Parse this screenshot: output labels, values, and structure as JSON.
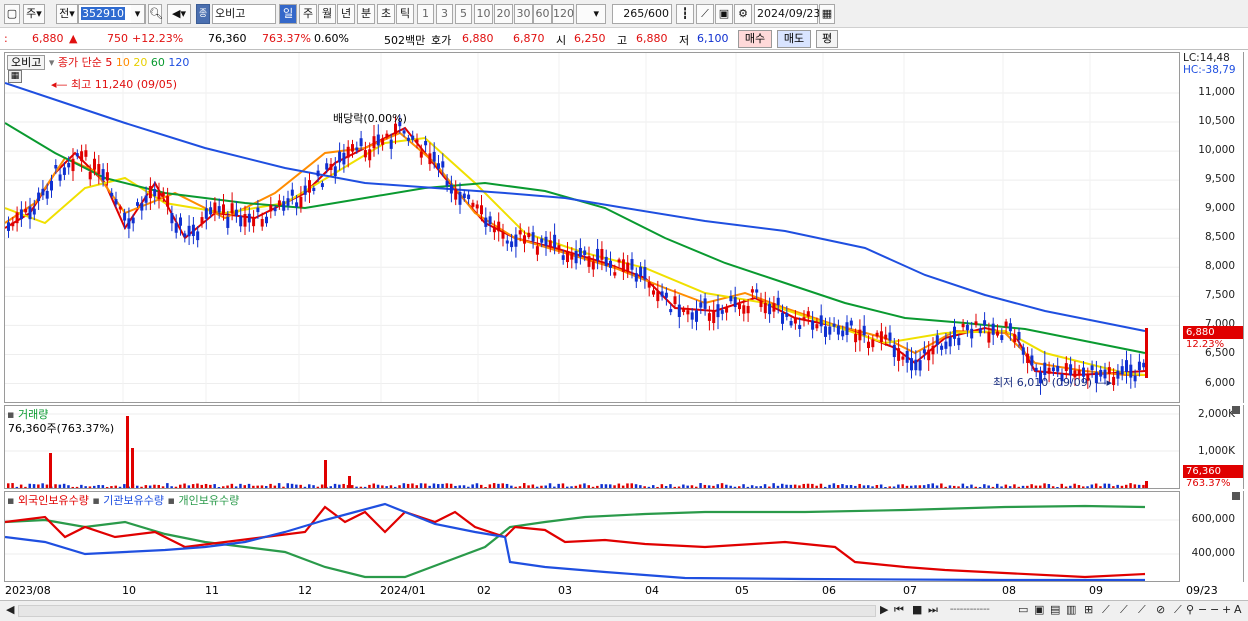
{
  "toolbar": {
    "type_label": "주",
    "prev_label": "전",
    "code": "352910",
    "name": "오비고",
    "period_tabs": [
      "일",
      "주",
      "월",
      "년",
      "분",
      "초",
      "틱"
    ],
    "interval_tabs": [
      "1",
      "3",
      "5",
      "10",
      "20",
      "30",
      "60",
      "120"
    ],
    "count_current": "265",
    "count_total": "/600",
    "date": "2024/09/23"
  },
  "quote": {
    "price": "6,880",
    "up_arrow": "▲",
    "change": "750",
    "change_pct": "+12.23%",
    "volume": "76,360",
    "volume_pct": "763.37%",
    "turnover_pct": "0.60%",
    "amount": "502백만",
    "hoga_label": "호가",
    "ask": "6,880",
    "bid": "6,870",
    "open_label": "시",
    "open": "6,250",
    "high_label": "고",
    "high": "6,880",
    "low_label": "저",
    "low": "6,100",
    "buy_label": "매수",
    "sell_label": "매도",
    "eval_label": "평"
  },
  "price_panel": {
    "name_tag": "오비고",
    "legend_prefix": "종가 단순",
    "ma_labels": [
      "5",
      "10",
      "20",
      "60",
      "120"
    ],
    "ma_colors": [
      "#e00000",
      "#ff8c00",
      "#f0e000",
      "#0a9a30",
      "#1f4fe0"
    ],
    "high_note": "최고 11,240 (09/05)",
    "low_note": "최저 6,010 (09/09)",
    "dividend_note": "배당락(0.00%)",
    "lc_label": "LC:14,48",
    "hc_label": "HC:-38,79",
    "last_price_tag": "6,880",
    "last_pct_tag": "12.23%",
    "y_ticks": [
      "11,000",
      "10,500",
      "10,000",
      "9,500",
      "9,000",
      "8,500",
      "8,000",
      "7,500",
      "7,000",
      "6,500",
      "6,000"
    ]
  },
  "volume_panel": {
    "title": "거래량",
    "value_label": "76,360주(763.37%)",
    "y_ticks": [
      "2,000K",
      "1,000K"
    ],
    "last_tag": "76,360",
    "last_pct": "763.37%"
  },
  "holding_panel": {
    "legend": [
      "외국인보유수량",
      "기관보유수량",
      "개인보유수량"
    ],
    "colors": [
      "#e00000",
      "#1f4fe0",
      "#2a9a4a"
    ],
    "y_ticks": [
      "600,000",
      "400,000"
    ]
  },
  "x_axis": [
    "2023/08",
    "10",
    "11",
    "12",
    "2024/01",
    "02",
    "03",
    "04",
    "05",
    "06",
    "07",
    "08",
    "09",
    "09/23"
  ]
}
